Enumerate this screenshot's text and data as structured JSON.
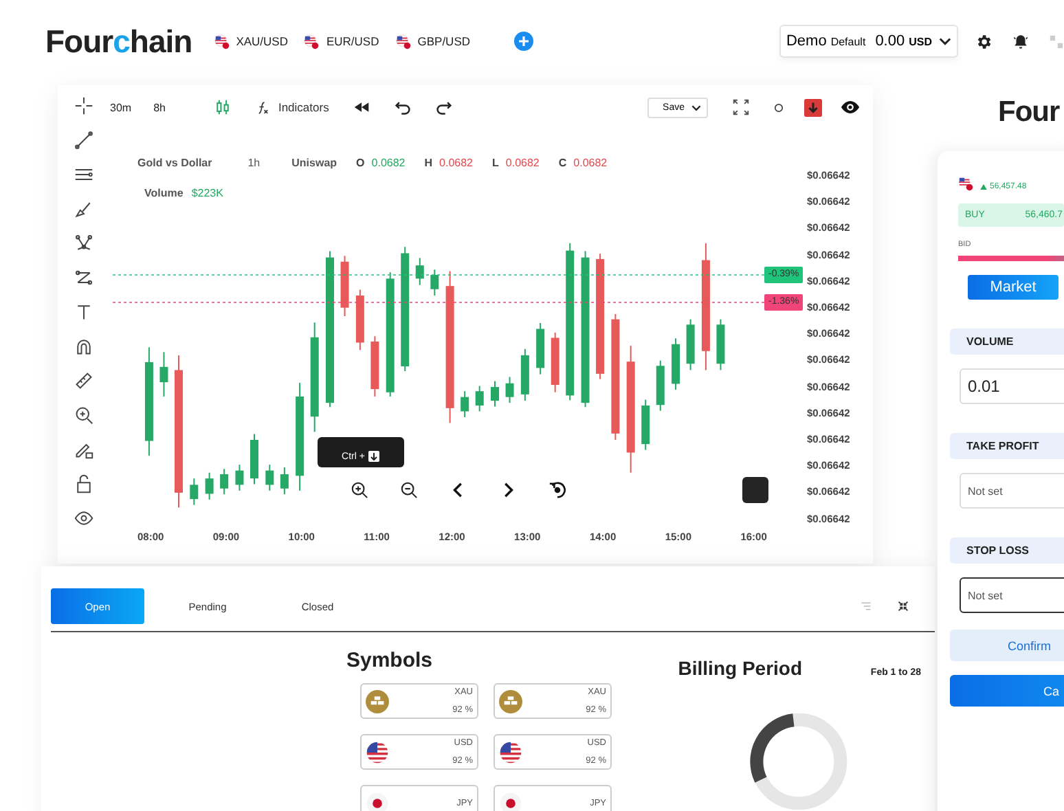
{
  "header": {
    "logo": {
      "start": "Four",
      "accent": "c",
      "end": "hain"
    },
    "pairs": [
      {
        "label": "XAU/USD"
      },
      {
        "label": "EUR/USD"
      },
      {
        "label": "GBP/USD"
      }
    ],
    "account": {
      "mode": "Demo",
      "type": "Default",
      "balance": "0.00",
      "currency": "USD"
    }
  },
  "chart": {
    "intervals": [
      "30m",
      "8h"
    ],
    "indicators": "Indicators",
    "save": "Save",
    "legend": {
      "name": "Gold vs Dollar",
      "interval": "1h",
      "exchange": "Uniswap",
      "ohlc": [
        {
          "label": "O",
          "value": "0.0682",
          "color": "#22a861"
        },
        {
          "label": "H",
          "value": "0.0682",
          "color": "#e5484d"
        },
        {
          "label": "L",
          "value": "0.0682",
          "color": "#e5484d"
        },
        {
          "label": "C",
          "value": "0.0682",
          "color": "#e5484d"
        }
      ],
      "volume_label": "Volume",
      "volume": "$223K"
    },
    "price_axis": [
      "$0.06642",
      "$0.06642",
      "$0.06642",
      "$0.06642",
      "$0.06642",
      "$0.06642",
      "$0.06642",
      "$0.06642",
      "$0.06642",
      "$0.06642",
      "$0.06642",
      "$0.06642",
      "$0.06642",
      "$0.06642"
    ],
    "time_axis": [
      "08:00",
      "09:00",
      "10:00",
      "11:00",
      "12:00",
      "13:00",
      "14:00",
      "15:00",
      "16:00"
    ],
    "price_tags": [
      {
        "text": "-0.39%",
        "color": "#1fc47a"
      },
      {
        "text": "-1.36%",
        "color": "#f0457a"
      }
    ],
    "tooltip": "Ctrl +"
  },
  "positions": {
    "tabs": [
      {
        "label": "Open",
        "selected": true
      },
      {
        "label": "Pending",
        "selected": false
      },
      {
        "label": "Closed",
        "selected": false
      }
    ],
    "symbols_title": "Symbols",
    "symbols": [
      {
        "kind": "gold",
        "code": "XAU",
        "share": "92 %"
      },
      {
        "kind": "gold",
        "code": "XAU",
        "share": "92 %"
      },
      {
        "kind": "usd",
        "code": "USD",
        "share": "92 %"
      },
      {
        "kind": "usd",
        "code": "USD",
        "share": "92 %"
      },
      {
        "kind": "jpy",
        "code": "JPY"
      },
      {
        "kind": "jpy",
        "code": "JPY"
      }
    ],
    "billing_title": "Billing Period",
    "billing_range": "Feb 1 to 28"
  },
  "trade": {
    "logo": "Four",
    "ticker": "56,457.48",
    "buy_label": "BUY",
    "buy_price": "56,460.7",
    "bid_label": "BID",
    "market": "Market",
    "fields": [
      {
        "label": "VOLUME",
        "value": "0.01",
        "focused": false
      },
      {
        "label": "TAKE PROFIT",
        "placeholder": "Not set",
        "focused": false
      },
      {
        "label": "STOP LOSS",
        "placeholder": "Not set",
        "focused": true
      }
    ],
    "confirm": "Confirm",
    "submit": "Ca"
  }
}
